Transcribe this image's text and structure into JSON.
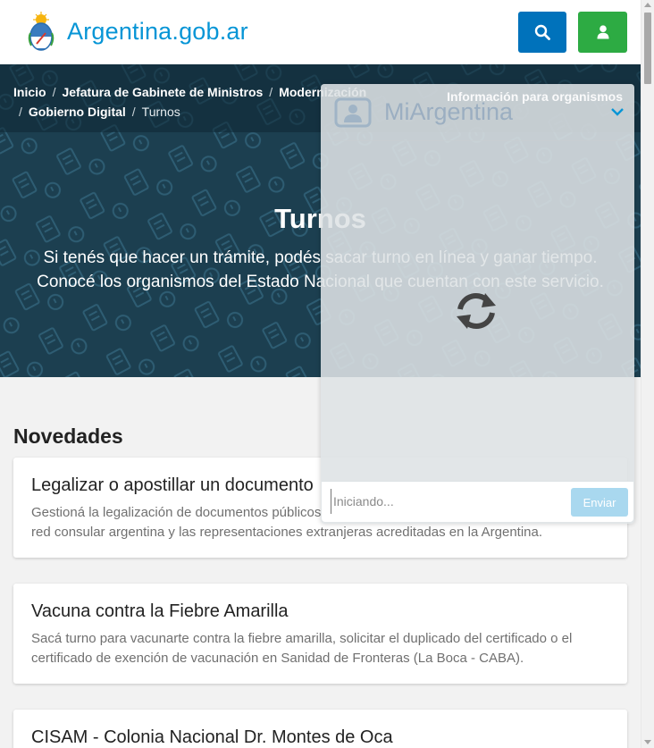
{
  "header": {
    "logo_text": "Argentina.gob.ar",
    "search_icon": "search-icon",
    "user_icon": "user-icon",
    "colors": {
      "brand": "#0695d6",
      "search_button": "#0072bb",
      "user_button": "#2dab43"
    }
  },
  "breadcrumb": {
    "items": [
      "Inicio",
      "Jefatura de Gabinete de Ministros",
      "Modernización",
      "Gobierno Digital"
    ],
    "current": "Turnos"
  },
  "hero": {
    "title": "Turnos",
    "subtitle_line1": "Si tenés que hacer un trámite, podés sacar turno en línea y ganar tiempo.",
    "subtitle_line2": "Conocé los organismos del Estado Nacional que cuentan con este servicio."
  },
  "novedades": {
    "title": "Novedades",
    "cards": [
      {
        "title": "Legalizar o apostillar un documento",
        "description": "Gestioná la legalización de documentos públicos, emitidos tanto por nuestro país como por la red consular argentina y las representaciones extranjeras acreditadas en la Argentina."
      },
      {
        "title": "Vacuna contra la Fiebre Amarilla",
        "description": "Sacá turno para vacunarte contra la fiebre amarilla, solicitar el duplicado del certificado o el certificado de exención de vacunación en Sanidad de Fronteras (La Boca - CABA)."
      },
      {
        "title": "CISAM - Colonia Nacional Dr. Montes de Oca",
        "description": ""
      }
    ]
  },
  "chat": {
    "header_info": "Información para organismos",
    "logo_text": "MiArgentina",
    "input_placeholder": "Iniciando...",
    "send_label": "Enviar",
    "spinner_icon": "refresh-icon",
    "chevron_icon": "chevron-down-icon"
  }
}
